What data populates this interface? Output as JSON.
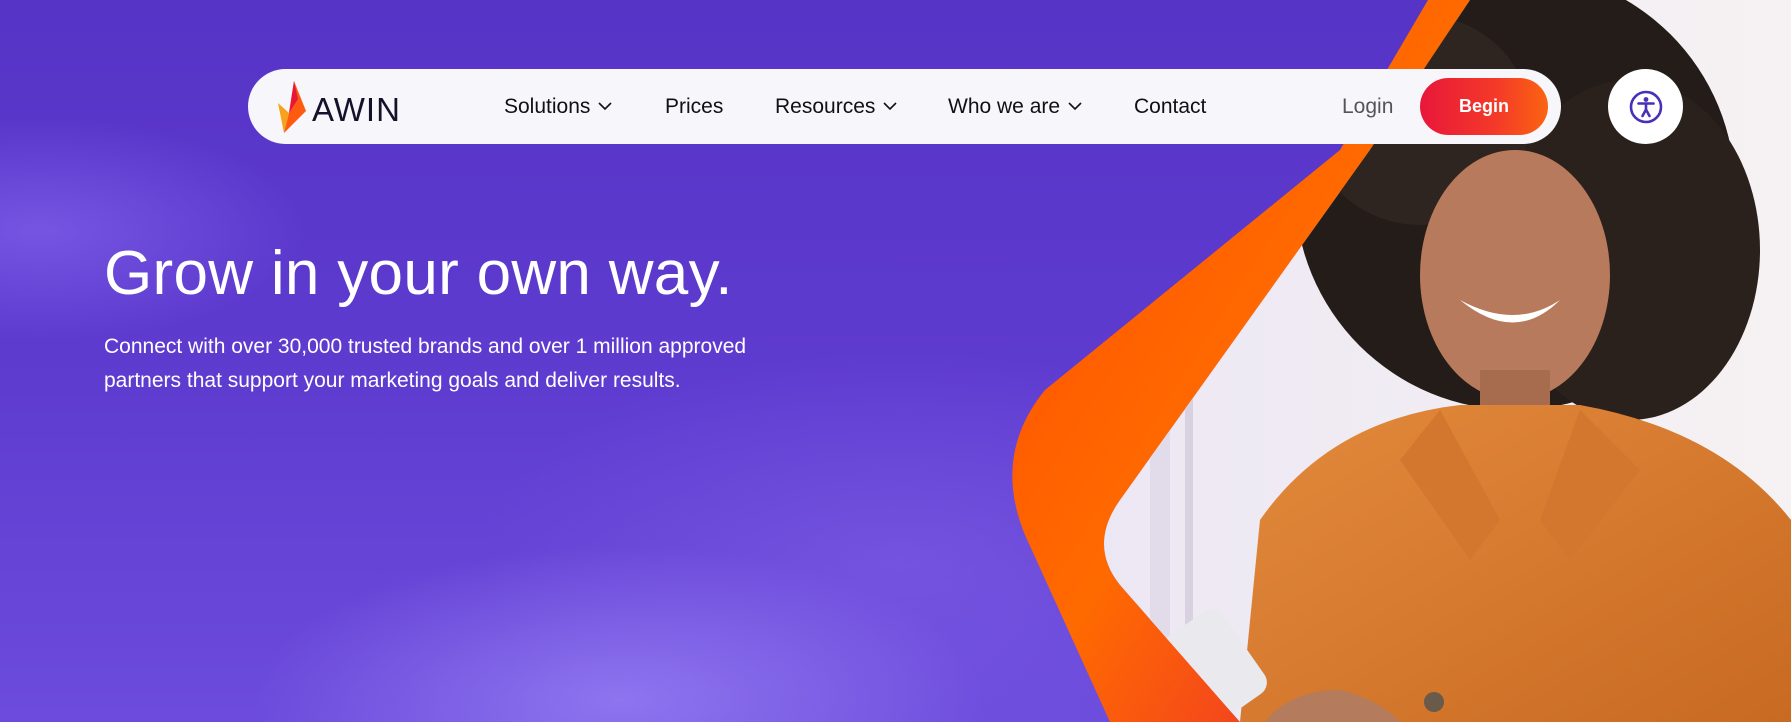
{
  "brand": {
    "name": "AWIN"
  },
  "nav": {
    "items": [
      {
        "label": "Solutions",
        "has_dropdown": true
      },
      {
        "label": "Prices",
        "has_dropdown": false
      },
      {
        "label": "Resources",
        "has_dropdown": true
      },
      {
        "label": "Who we are",
        "has_dropdown": true
      },
      {
        "label": "Contact",
        "has_dropdown": false
      }
    ],
    "login_label": "Login",
    "begin_label": "Begin"
  },
  "accessibility": {
    "icon": "accessibility-icon"
  },
  "hero": {
    "title": "Grow in your own way.",
    "subtitle_line1": "Connect with over 30,000 trusted brands and over 1 million approved",
    "subtitle_line2": "partners that support your marketing goals and deliver results.",
    "image": "smiling-woman-with-phone"
  },
  "colors": {
    "background": "#5b38cc",
    "accent_orange": "#ff6a00",
    "accent_red": "#e8173a",
    "accessibility_icon": "#4a2fb8"
  }
}
